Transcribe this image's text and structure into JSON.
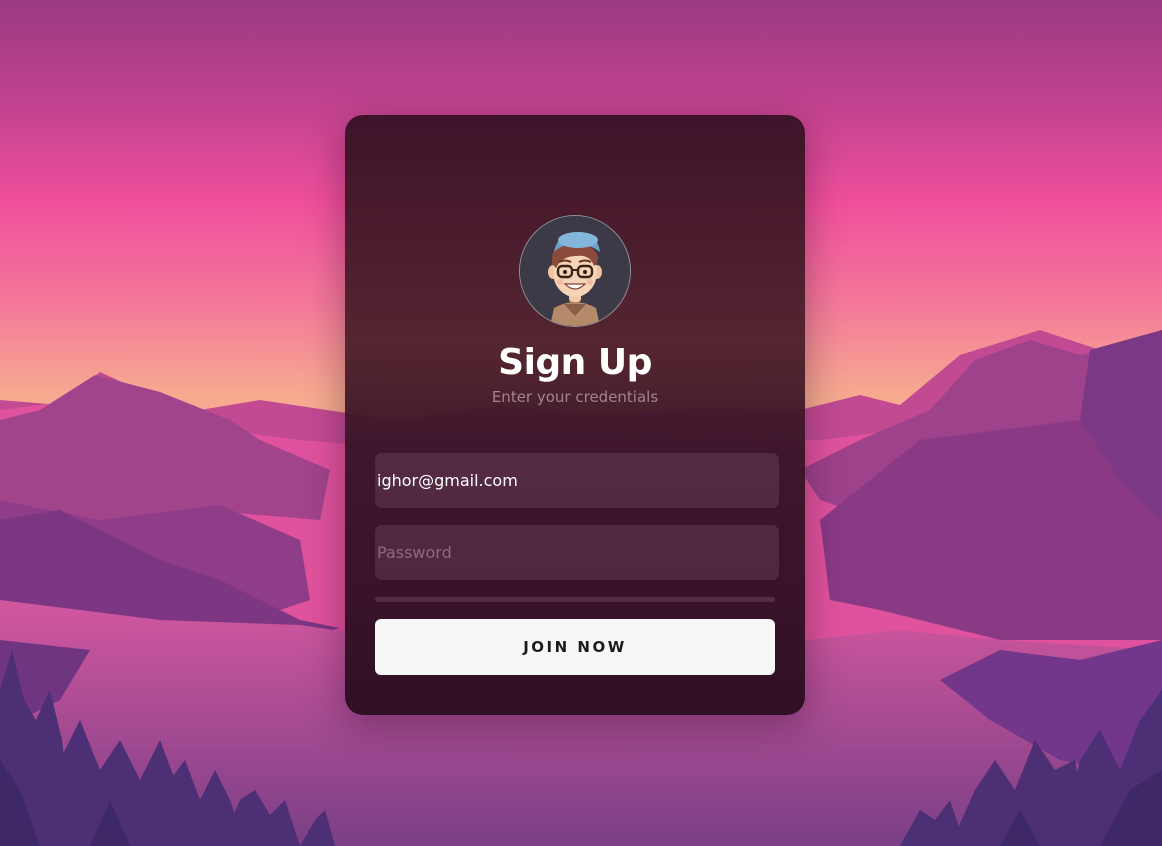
{
  "signup": {
    "title": "Sign Up",
    "subtitle": "Enter your credentials",
    "email": {
      "value": "ighor@gmail.com",
      "placeholder": ""
    },
    "password": {
      "value": "",
      "placeholder": "Password"
    },
    "join_label": "JOIN NOW"
  },
  "avatar": {
    "icon": "avatar-cartoon-person"
  },
  "colors": {
    "sky_top": "#9c3b84",
    "sky_pink": "#f04d9c",
    "horizon_peach": "#f7a88f",
    "mountain_purple": "#8c3a86",
    "card_bg": "#3a1226",
    "button_bg": "#f7f7f7"
  }
}
